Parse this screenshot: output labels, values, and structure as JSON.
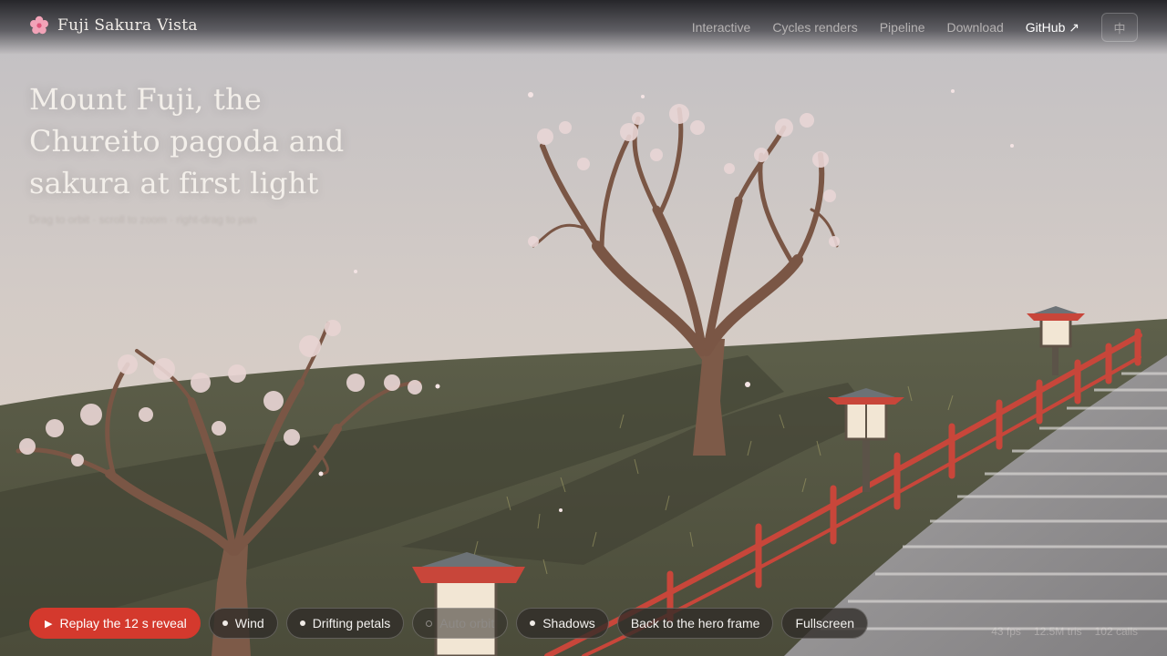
{
  "header": {
    "brand_name": "Fuji Sakura Vista",
    "brand_icon": "cherry-blossom-icon",
    "nav": [
      {
        "label": "Interactive"
      },
      {
        "label": "Cycles renders"
      },
      {
        "label": "Pipeline"
      },
      {
        "label": "Download"
      },
      {
        "label": "GitHub ↗"
      }
    ],
    "lang_toggle": "中"
  },
  "hero": {
    "title": "Mount Fuji, the Chureito pagoda and sakura at first light",
    "hint": "Drag to orbit · scroll to zoom · right-drag to pan"
  },
  "controls": {
    "replay": "Replay the 12 s reveal",
    "wind": "Wind",
    "petals": "Drifting petals",
    "auto_orbit": "Auto orbit",
    "shadows": "Shadows",
    "hero_frame": "Back to the hero frame",
    "fullscreen": "Fullscreen"
  },
  "stats": {
    "fps": "43 fps",
    "tris": "12.5M tris",
    "calls": "102 calls"
  },
  "colors": {
    "accent": "#d4392d",
    "railing": "#c8463a",
    "hill": "#5b5d48",
    "sky_top": "#c2c0c4",
    "sky_bottom": "#dccdc0"
  }
}
